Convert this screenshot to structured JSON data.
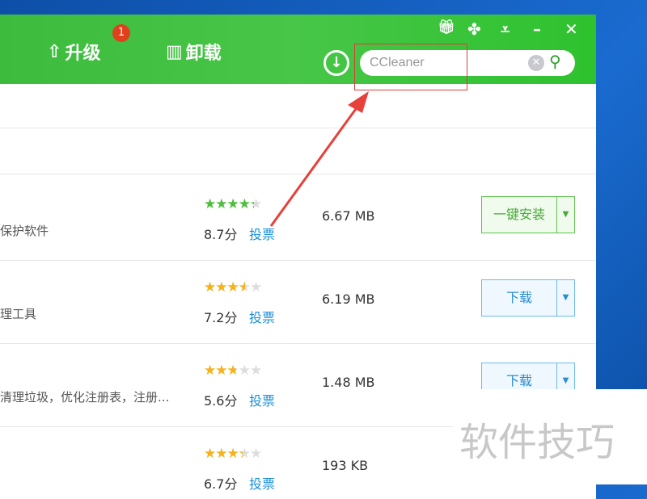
{
  "header": {
    "upgrade_label": "升级",
    "upgrade_badge": "1",
    "uninstall_label": "卸载"
  },
  "search": {
    "value": "CCleaner"
  },
  "rows": [
    {
      "desc": "保护软件",
      "stars": "★★★★★",
      "score": "8.7分",
      "vote": "投票",
      "size": "6.67 MB",
      "button": "一键安装",
      "type": "install",
      "rating": 4.35
    },
    {
      "desc": "理工具",
      "stars": "★★★★★",
      "score": "7.2分",
      "vote": "投票",
      "size": "6.19 MB",
      "button": "下载",
      "type": "download",
      "rating": 3.6
    },
    {
      "desc": "清理垃圾，优化注册表，注册...",
      "stars": "★★★★★",
      "score": "5.6分",
      "vote": "投票",
      "size": "1.48 MB",
      "button": "下载",
      "type": "download",
      "rating": 2.8
    },
    {
      "desc": "",
      "stars": "★★★★★",
      "score": "6.7分",
      "vote": "投票",
      "size": "193 KB",
      "button": "",
      "type": "none",
      "rating": 3.35
    }
  ],
  "watermark": "软件技巧"
}
